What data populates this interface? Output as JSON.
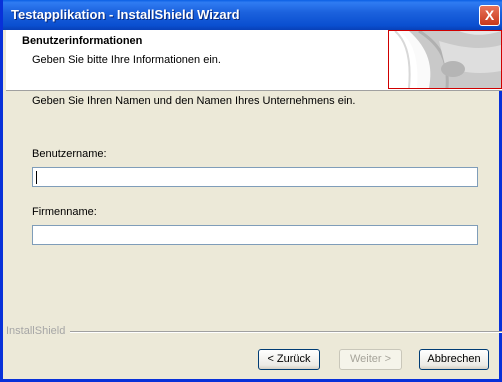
{
  "window": {
    "title": "Testapplikation - InstallShield Wizard",
    "close_label": "X"
  },
  "header": {
    "title": "Benutzerinformationen",
    "subtitle": "Geben Sie bitte Ihre Informationen ein."
  },
  "instruction": "Geben Sie Ihren Namen und den Namen Ihres Unternehmens ein.",
  "form": {
    "username_label": "Benutzername:",
    "username_value": "",
    "company_label": "Firmenname:",
    "company_value": ""
  },
  "footer": {
    "brand": "InstallShield",
    "back_label": "< Zurück",
    "next_label": "Weiter >",
    "cancel_label": "Abbrechen"
  },
  "colors": {
    "titlebar": "#0a4fd0",
    "header_frame": "#d00000",
    "background": "#ece9d8"
  }
}
